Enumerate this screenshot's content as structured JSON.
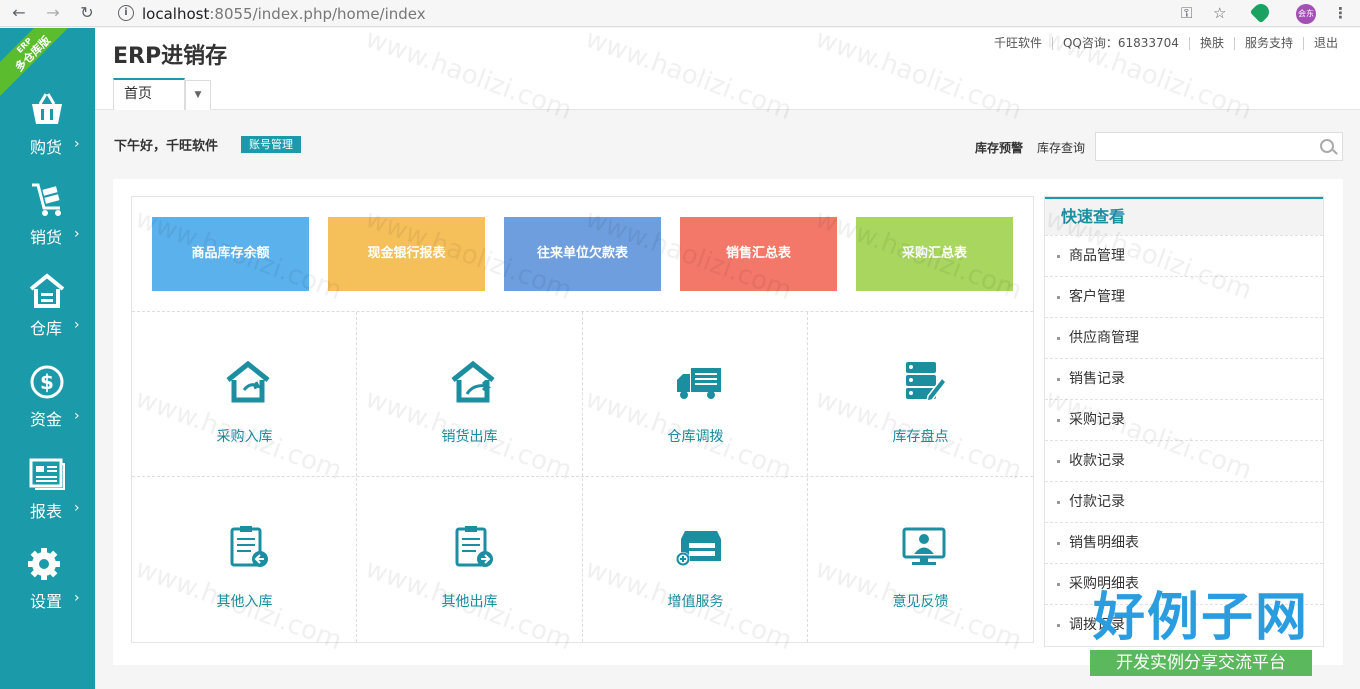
{
  "browser": {
    "url_host": "localhost",
    "url_rest": ":8055/index.php/home/index",
    "avatar_text": "会东"
  },
  "sidebar": {
    "ribbon_top": "ERP",
    "ribbon_main": "多仓库版",
    "items": [
      {
        "label": "购货",
        "icon": "basket-icon"
      },
      {
        "label": "销货",
        "icon": "cart-icon"
      },
      {
        "label": "仓库",
        "icon": "warehouse-icon"
      },
      {
        "label": "资金",
        "icon": "dollar-icon"
      },
      {
        "label": "报表",
        "icon": "report-icon"
      },
      {
        "label": "设置",
        "icon": "gear-icon"
      }
    ],
    "arrow": "›"
  },
  "header": {
    "title": "ERP进销存",
    "links": [
      "千旺软件",
      "QQ咨询：61833704",
      "换肤",
      "服务支持",
      "退出"
    ],
    "tab_home": "首页"
  },
  "greeting": {
    "text": "下午好，千旺软件",
    "account_button": "账号管理",
    "stock_warning": "库存预警",
    "stock_query": "库存查询"
  },
  "tiles": [
    {
      "label": "商品库存余额",
      "color": "#5bb1ec"
    },
    {
      "label": "现金银行报表",
      "color": "#f5c05a"
    },
    {
      "label": "往来单位欠款表",
      "color": "#6e9ede"
    },
    {
      "label": "销售汇总表",
      "color": "#f3786a"
    },
    {
      "label": "采购汇总表",
      "color": "#a8d65f"
    }
  ],
  "functions": [
    {
      "label": "采购入库",
      "icon": "house-in-icon"
    },
    {
      "label": "销货出库",
      "icon": "house-out-icon"
    },
    {
      "label": "仓库调拨",
      "icon": "truck-icon"
    },
    {
      "label": "库存盘点",
      "icon": "server-edit-icon"
    },
    {
      "label": "其他入库",
      "icon": "clipboard-in-icon"
    },
    {
      "label": "其他出库",
      "icon": "clipboard-out-icon"
    },
    {
      "label": "增值服务",
      "icon": "cabinet-plus-icon"
    },
    {
      "label": "意见反馈",
      "icon": "monitor-user-icon"
    }
  ],
  "quick_view": {
    "title": "快速查看",
    "items": [
      "商品管理",
      "客户管理",
      "供应商管理",
      "销售记录",
      "采购记录",
      "收款记录",
      "付款记录",
      "销售明细表",
      "采购明细表",
      "调拨记录"
    ]
  },
  "watermark": {
    "text": "www.haolizi.com",
    "logo_main": "好例子网",
    "logo_sub": "开发实例分享交流平台"
  },
  "colors": {
    "accent": "#1b9aaa",
    "link": "#1b8ea0"
  }
}
